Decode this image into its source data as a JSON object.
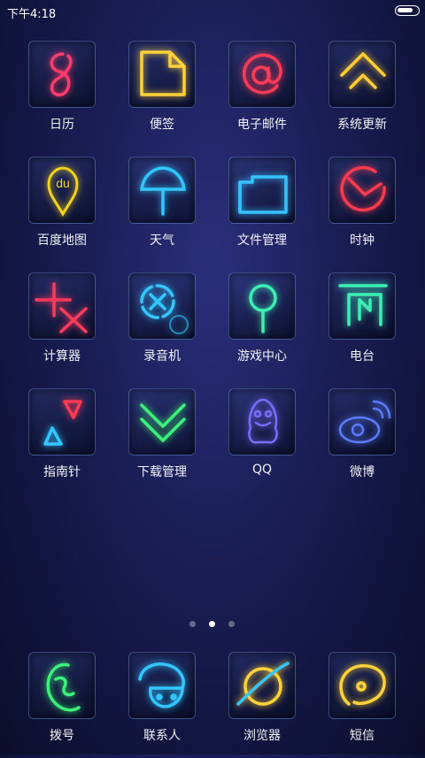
{
  "status_bar": {
    "time": "下午4:18",
    "battery_level": 0.85
  },
  "apps": [
    {
      "label": "日历",
      "icon": "calendar-icon",
      "color": "#ff3b6b"
    },
    {
      "label": "便签",
      "icon": "notes-icon",
      "color": "#ffd23a"
    },
    {
      "label": "电子邮件",
      "icon": "email-icon",
      "color": "#ff3b55"
    },
    {
      "label": "系统更新",
      "icon": "system-update-icon",
      "color": "#ffcc33"
    },
    {
      "label": "百度地图",
      "icon": "baidu-map-icon",
      "color": "#f2d21c"
    },
    {
      "label": "天气",
      "icon": "weather-umbrella-icon",
      "color": "#32c8ff"
    },
    {
      "label": "文件管理",
      "icon": "file-manager-icon",
      "color": "#36c2ff"
    },
    {
      "label": "时钟",
      "icon": "clock-icon",
      "color": "#ff3a4e"
    },
    {
      "label": "计算器",
      "icon": "calculator-icon",
      "color": "#ff3b5c"
    },
    {
      "label": "录音机",
      "icon": "recorder-icon",
      "color": "#34c6ff"
    },
    {
      "label": "游戏中心",
      "icon": "game-center-icon",
      "color": "#3cf0b4"
    },
    {
      "label": "电台",
      "icon": "radio-icon",
      "color": "#3cf0b4"
    },
    {
      "label": "指南针",
      "icon": "compass-icon",
      "color": "#ff3b55"
    },
    {
      "label": "下载管理",
      "icon": "download-icon",
      "color": "#3cf07a"
    },
    {
      "label": "QQ",
      "icon": "qq-penguin-icon",
      "color": "#7a6cff"
    },
    {
      "label": "微博",
      "icon": "weibo-icon",
      "color": "#5b7cff"
    }
  ],
  "pager": {
    "pages": 3,
    "active_page": 2
  },
  "dock": [
    {
      "label": "拨号",
      "icon": "phone-dialer-icon",
      "color": "#3cf07a"
    },
    {
      "label": "联系人",
      "icon": "contacts-icon",
      "color": "#34c6ff"
    },
    {
      "label": "浏览器",
      "icon": "browser-icon",
      "color": "#ffd23a"
    },
    {
      "label": "短信",
      "icon": "messages-icon",
      "color": "#ffd23a"
    }
  ]
}
